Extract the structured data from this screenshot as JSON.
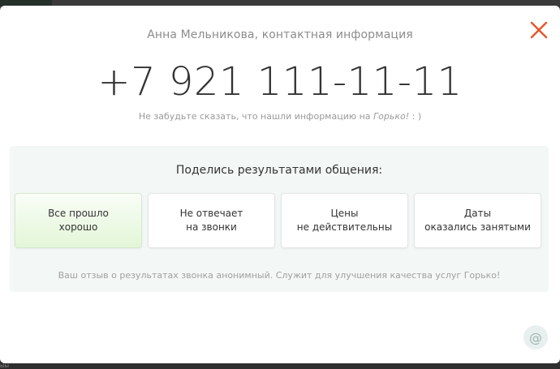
{
  "header": {
    "contact_title": "Анна Мельникова, контактная информация"
  },
  "contact": {
    "phone": "+7 921 111-11-11",
    "reminder_prefix": "Не забудьте сказать, что нашли информацию на ",
    "reminder_brand": "Горько!",
    "reminder_suffix": " : )"
  },
  "feedback": {
    "title": "Поделись результатами общения:",
    "options": [
      {
        "label": "Все прошло\nхорошо"
      },
      {
        "label": "Не отвечает\nна звонки"
      },
      {
        "label": "Цены\nне действительны"
      },
      {
        "label": "Даты\nоказались занятыми"
      }
    ],
    "note": "Ваш отзыв о результатах звонка анонимный. Служит для улучшения качества услуг Горько!"
  },
  "icons": {
    "close": "close-icon",
    "at": "at-sign-icon"
  },
  "colors": {
    "close": "#e8542a",
    "good_option": "#e3f6d7",
    "panel": "#f3f7f6"
  }
}
